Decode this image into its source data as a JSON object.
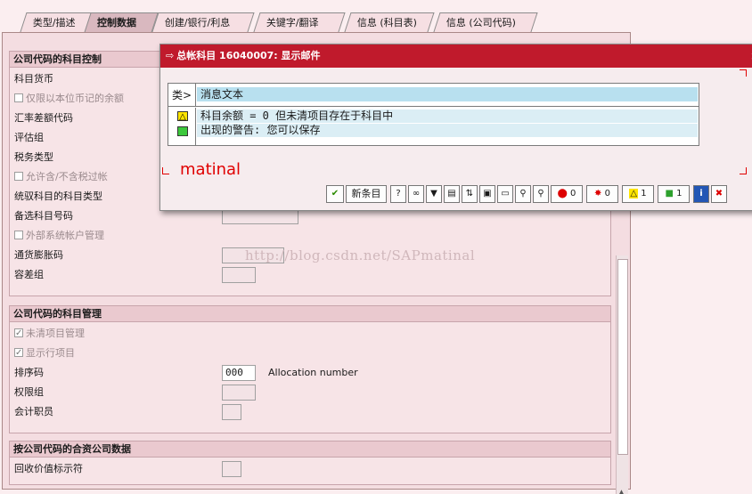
{
  "tabs": [
    "类型/描述",
    "控制数据",
    "创建/银行/利息",
    "关键字/翻译",
    "信息 (科目表)",
    "信息 (公司代码)"
  ],
  "groups": {
    "control": {
      "title": "公司代码的科目控制",
      "rows": [
        "科目货币",
        "仅限以本位币记的余额",
        "汇率差额代码",
        "评估组",
        "税务类型",
        "允许含/不含税过帐",
        "统驭科目的科目类型",
        "备选科目号码",
        "外部系统帐户管理",
        "通货膨胀码",
        "容差组"
      ]
    },
    "management": {
      "title": "公司代码的科目管理",
      "rows": [
        "未清项目管理",
        "显示行项目",
        "排序码",
        "权限组",
        "会计职员"
      ],
      "sort_key_value": "000",
      "sort_key_desc": "Allocation number"
    },
    "jv": {
      "title": "按公司代码的合资公司数据",
      "rows": [
        "回收价值标示符"
      ]
    }
  },
  "watermark": "http://blog.csdn.net/SAPmatinal",
  "dialog": {
    "title": "总帐科目 16040007: 显示邮件",
    "close": "×",
    "col_type": "类>",
    "col_text": "消息文本",
    "messages": [
      "科目余额 = 0 但未清项目存在于科目中",
      "出现的警告: 您可以保存"
    ],
    "signature": "matinal",
    "toolbar": {
      "new_entry": "新条目",
      "stop_count": "0",
      "error_count": "0",
      "warn_count": "1",
      "ok_count": "1"
    }
  },
  "colors": {
    "title_bar": "#c01a2c",
    "background": "#fbeef0",
    "signature": "#e00000"
  }
}
